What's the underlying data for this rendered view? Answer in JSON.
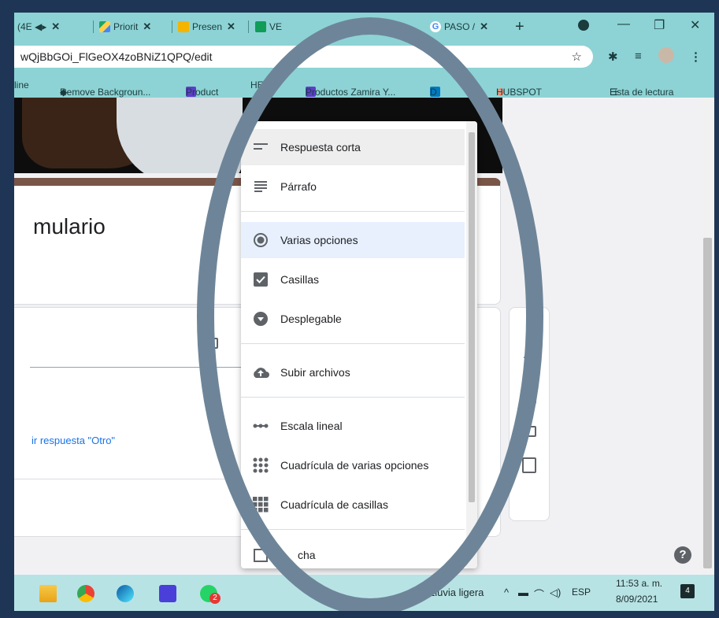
{
  "tabs": [
    {
      "label": "(4E ◀▸",
      "close": "✕"
    },
    {
      "label": "Priorit",
      "close": "✕"
    },
    {
      "label": "Presen",
      "close": "✕"
    },
    {
      "label": "VE",
      "close": ""
    },
    {
      "label": "PASO /",
      "close": "✕"
    }
  ],
  "new_tab": "+",
  "address": {
    "url": "wQjBbGOi_FlGeOX4zoBNiZ1QPQ/edit"
  },
  "bookmarks": [
    {
      "label": "line"
    },
    {
      "label": "Remove Backgroun..."
    },
    {
      "label": "Product"
    },
    {
      "label": "HEL..."
    },
    {
      "label": "Productos Zamira Y..."
    },
    {
      "label": "D"
    },
    {
      "label": "HUBSPOT"
    },
    {
      "label": "Lista de lectura"
    }
  ],
  "form": {
    "title_partial": "mulario",
    "add_other": "ir respuesta \"Otro\""
  },
  "menu": {
    "items": [
      {
        "label": "Respuesta corta",
        "icon": "short-answer-icon"
      },
      {
        "label": "Párrafo",
        "icon": "paragraph-icon"
      },
      {
        "label": "Varias opciones",
        "icon": "radio-icon"
      },
      {
        "label": "Casillas",
        "icon": "checkbox-icon"
      },
      {
        "label": "Desplegable",
        "icon": "dropdown-icon"
      },
      {
        "label": "Subir archivos",
        "icon": "upload-cloud-icon"
      },
      {
        "label": "Escala lineal",
        "icon": "linear-scale-icon"
      },
      {
        "label": "Cuadrícula de varias opciones",
        "icon": "multiple-choice-grid-icon"
      },
      {
        "label": "Cuadrícula de casillas",
        "icon": "checkbox-grid-icon"
      },
      {
        "label": "cha",
        "icon": "date-icon"
      }
    ]
  },
  "help": "?",
  "taskbar": {
    "weather": "C  Lluvia ligera",
    "lang": "ESP",
    "time": "11:53 a. m.",
    "date": "8/09/2021",
    "notif": "4",
    "whatsapp_badge": "2"
  },
  "colors": {
    "chrome_accent": "#8dd3d5",
    "overlay_ring": "#6e8599",
    "link": "#1a73e8"
  }
}
